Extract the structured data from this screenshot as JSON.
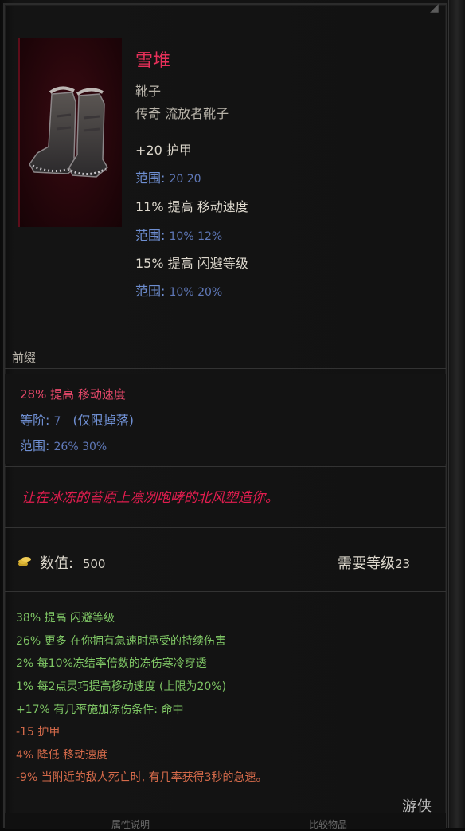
{
  "item": {
    "name": "雪堆",
    "slot": "靴子",
    "rarity_base": "传奇 流放者靴子"
  },
  "implicits": [
    {
      "text": "+20 护甲",
      "range_label": "范围:",
      "range": "20  20"
    },
    {
      "text": "11% 提高 移动速度",
      "range_label": "范围:",
      "range": "10%  12%"
    },
    {
      "text": "15% 提高 闪避等级",
      "range_label": "范围:",
      "range": "10%  20%"
    }
  ],
  "prefix": {
    "header": "前缀",
    "affix": "28% 提高 移动速度",
    "tier_label": "等阶:",
    "tier_value": "7",
    "tier_note": "(仅限掉落)",
    "range_label": "范围:",
    "range": "26%  30%"
  },
  "flavor_text": "让在冰冻的苔原上凛冽咆哮的北风塑造你。",
  "value": {
    "label": "数值:",
    "amount": "500"
  },
  "level_req": {
    "label": "需要等级",
    "value": "23"
  },
  "mods_positive": [
    "38% 提高 闪避等级",
    "26% 更多 在你拥有急速时承受的持续伤害",
    "2% 每10%冻结率倍数的冻伤寒冷穿透",
    "1% 每2点灵巧提高移动速度 (上限为20%)",
    "+17% 有几率施加冻伤条件:  命中"
  ],
  "mods_negative": [
    "-15 护甲",
    "4% 降低 移动速度",
    "-9% 当附近的敌人死亡时, 有几率获得3秒的急速。"
  ],
  "footer": {
    "left": "属性说明",
    "right": "比较物品"
  },
  "watermark": "游侠",
  "colors": {
    "title": "#e8305a",
    "range": "#6f8fd2",
    "positive": "#7fc765",
    "negative": "#d46a4a",
    "flavor": "#e21d4f"
  },
  "icons": {
    "portrait": "boots-image",
    "value": "coin-stack-icon"
  }
}
